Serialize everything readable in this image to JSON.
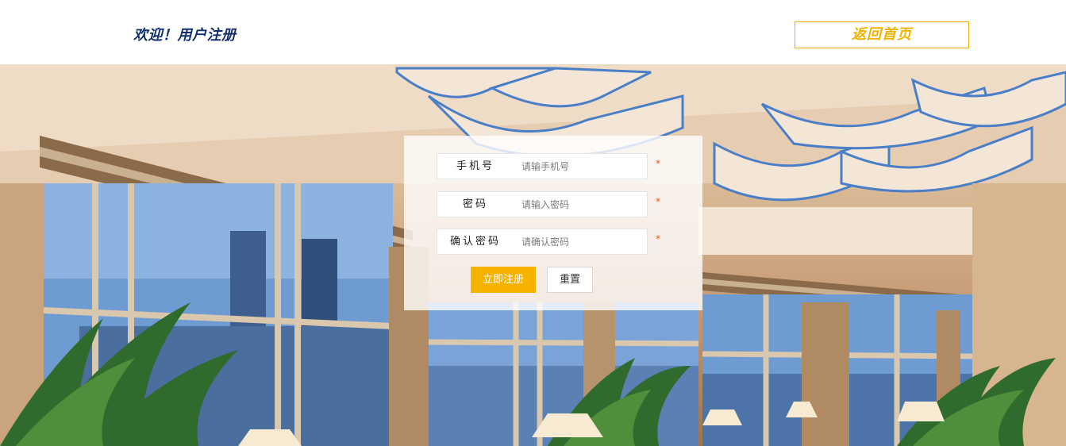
{
  "header": {
    "welcome_text": "欢迎！用户注册",
    "home_button_label": "返回首页"
  },
  "form": {
    "fields": [
      {
        "label": "手机号",
        "placeholder": "请输手机号",
        "required_mark": "*"
      },
      {
        "label": "密码",
        "placeholder": "请输入密码",
        "required_mark": "*"
      },
      {
        "label": "确认密码",
        "placeholder": "请确认密码",
        "required_mark": "*"
      }
    ],
    "submit_label": "立即注册",
    "reset_label": "重置"
  },
  "colors": {
    "brand_navy": "#12306b",
    "accent_yellow": "#f5b300",
    "required_red": "#e8502a"
  }
}
